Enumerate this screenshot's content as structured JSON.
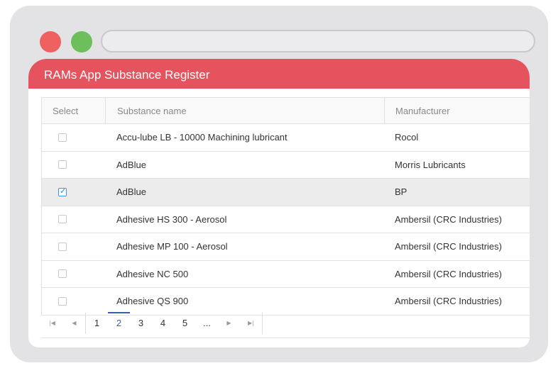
{
  "window": {
    "title": "RAMs App Substance Register"
  },
  "table": {
    "headers": {
      "select": "Select",
      "name": "Substance name",
      "manufacturer": "Manufacturer"
    },
    "rows": [
      {
        "name": "Accu-lube LB - 10000 Machining lubricant",
        "manufacturer": "Rocol",
        "checked": false
      },
      {
        "name": "AdBlue",
        "manufacturer": "Morris Lubricants",
        "checked": false
      },
      {
        "name": "AdBlue",
        "manufacturer": "BP",
        "checked": true
      },
      {
        "name": "Adhesive HS 300 - Aerosol",
        "manufacturer": "Ambersil (CRC Industries)",
        "checked": false
      },
      {
        "name": "Adhesive MP 100 - Aerosol",
        "manufacturer": "Ambersil (CRC Industries)",
        "checked": false
      },
      {
        "name": "Adhesive NC 500",
        "manufacturer": "Ambersil (CRC Industries)",
        "checked": false
      },
      {
        "name": "Adhesive QS 900",
        "manufacturer": "Ambersil (CRC Industries)",
        "checked": false
      }
    ]
  },
  "pager": {
    "first_icon": "first-page-icon",
    "prev_icon": "previous-page-icon",
    "next_icon": "next-page-icon",
    "last_icon": "last-page-icon",
    "pages": [
      "1",
      "2",
      "3",
      "4",
      "5"
    ],
    "current_page": "2",
    "more": "..."
  },
  "colors": {
    "accent": "#e5535e",
    "active_page": "#3e5ca8",
    "selected_row": "#ececec"
  }
}
